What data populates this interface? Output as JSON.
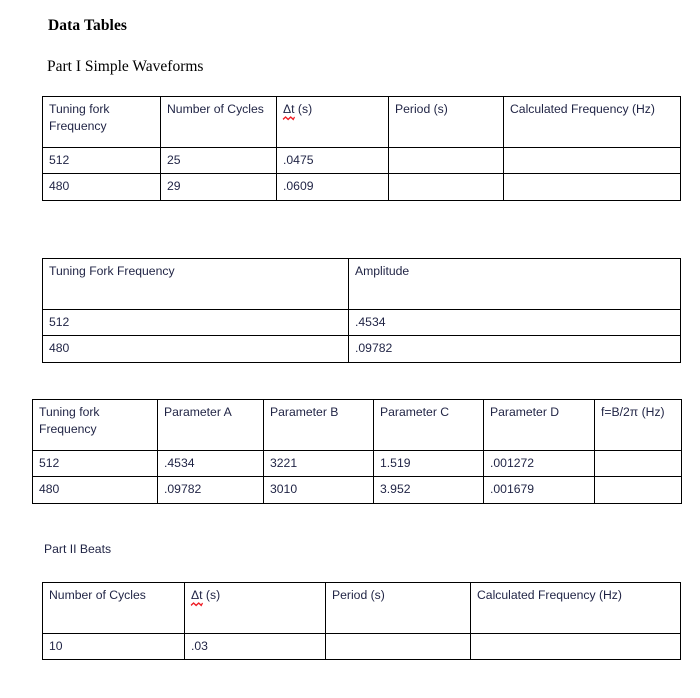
{
  "document": {
    "title": "Data Tables",
    "part1_heading": "Part I Simple Waveforms",
    "part2_heading": "Part II Beats"
  },
  "spellcheck_color": "#ee1c24",
  "tables": {
    "waveform_timing": {
      "name": "Part I simple waveform timing table",
      "headers": [
        "Tuning fork Frequency",
        "Number of Cycles",
        "Δt (s)",
        "Period (s)",
        "Calculated Frequency (Hz)"
      ],
      "header_delta_col": 2,
      "rows": [
        [
          "512",
          "25",
          ".0475",
          "",
          ""
        ],
        [
          "480",
          "29",
          ".0609",
          "",
          ""
        ]
      ]
    },
    "amplitude": {
      "name": "Amplitude table",
      "headers": [
        "Tuning Fork Frequency",
        "Amplitude"
      ],
      "rows": [
        [
          "512",
          ".4534"
        ],
        [
          "480",
          ".09782"
        ]
      ]
    },
    "parameters": {
      "name": "Fit parameters table",
      "headers": [
        "Tuning fork Frequency",
        "Parameter A",
        "Parameter B",
        "Parameter C",
        "Parameter D",
        "f=B/2π (Hz)"
      ],
      "rows": [
        [
          "512",
          ".4534",
          "3221",
          "1.519",
          ".001272",
          ""
        ],
        [
          "480",
          ".09782",
          "3010",
          "3.952",
          ".001679",
          ""
        ]
      ]
    },
    "beats": {
      "name": "Part II beats table",
      "headers": [
        "Number of Cycles",
        "Δt (s)",
        "Period (s)",
        "Calculated Frequency (Hz)"
      ],
      "header_delta_col": 1,
      "rows": [
        [
          "10",
          ".03",
          "",
          ""
        ]
      ]
    }
  }
}
